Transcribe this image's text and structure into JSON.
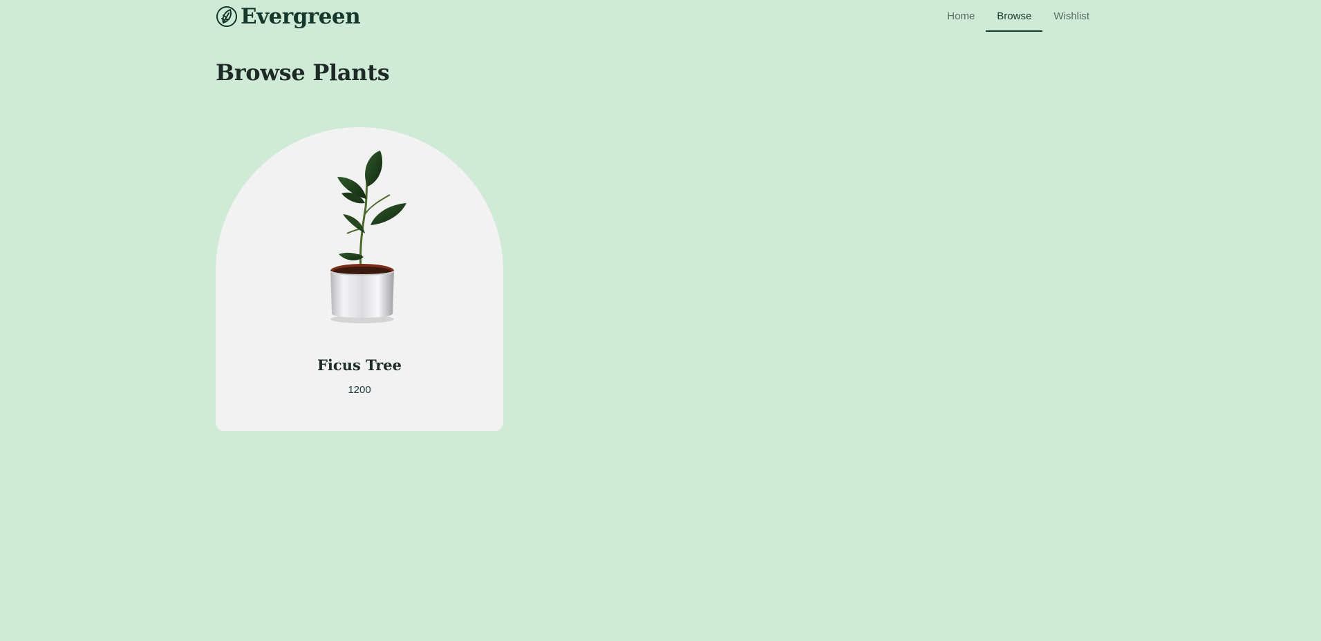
{
  "brand": {
    "name": "Evergreen",
    "logo_icon": "leaf-icon",
    "color": "#15382c"
  },
  "nav": {
    "items": [
      {
        "label": "Home",
        "active": false
      },
      {
        "label": "Browse",
        "active": true
      },
      {
        "label": "Wishlist",
        "active": false
      }
    ]
  },
  "page": {
    "title": "Browse Plants",
    "background": "#cfead6"
  },
  "products": [
    {
      "name": "Ficus Tree",
      "price": "1200",
      "image_icon": "potted-plant-image"
    }
  ]
}
